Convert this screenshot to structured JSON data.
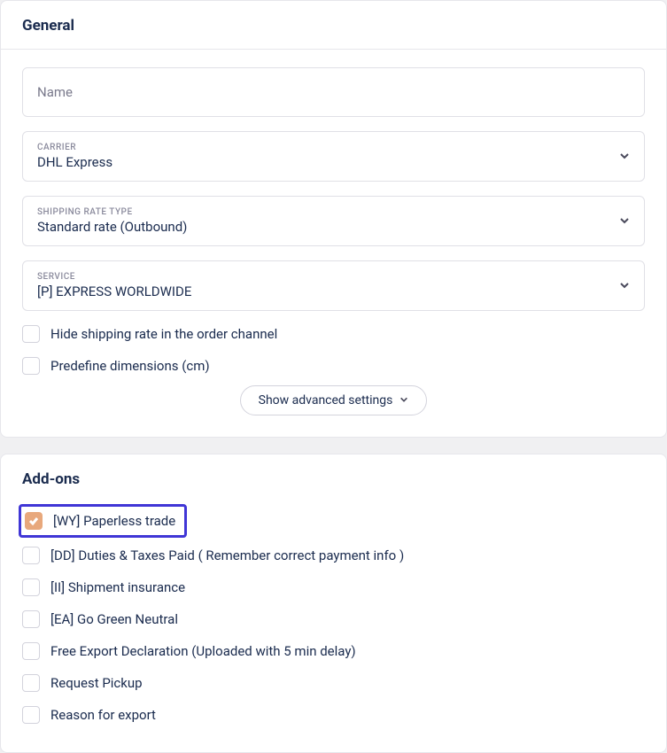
{
  "general": {
    "title": "General",
    "name_placeholder": "Name",
    "name_value": "",
    "carrier_label": "CARRIER",
    "carrier_value": "DHL Express",
    "rate_type_label": "SHIPPING RATE TYPE",
    "rate_type_value": "Standard rate (Outbound)",
    "service_label": "SERVICE",
    "service_value": "[P] EXPRESS WORLDWIDE",
    "hide_rate_label": "Hide shipping rate in the order channel",
    "predefine_dims_label": "Predefine dimensions (cm)",
    "advanced_button": "Show advanced settings"
  },
  "addons": {
    "title": "Add-ons",
    "items": [
      {
        "label": "[WY] Paperless trade",
        "checked": true,
        "highlighted": true
      },
      {
        "label": "[DD] Duties & Taxes Paid ( Remember correct payment info )",
        "checked": false,
        "highlighted": false
      },
      {
        "label": "[II] Shipment insurance",
        "checked": false,
        "highlighted": false
      },
      {
        "label": "[EA] Go Green Neutral",
        "checked": false,
        "highlighted": false
      },
      {
        "label": "Free Export Declaration (Uploaded with 5 min delay)",
        "checked": false,
        "highlighted": false
      },
      {
        "label": "Request Pickup",
        "checked": false,
        "highlighted": false
      },
      {
        "label": "Reason for export",
        "checked": false,
        "highlighted": false
      }
    ]
  }
}
